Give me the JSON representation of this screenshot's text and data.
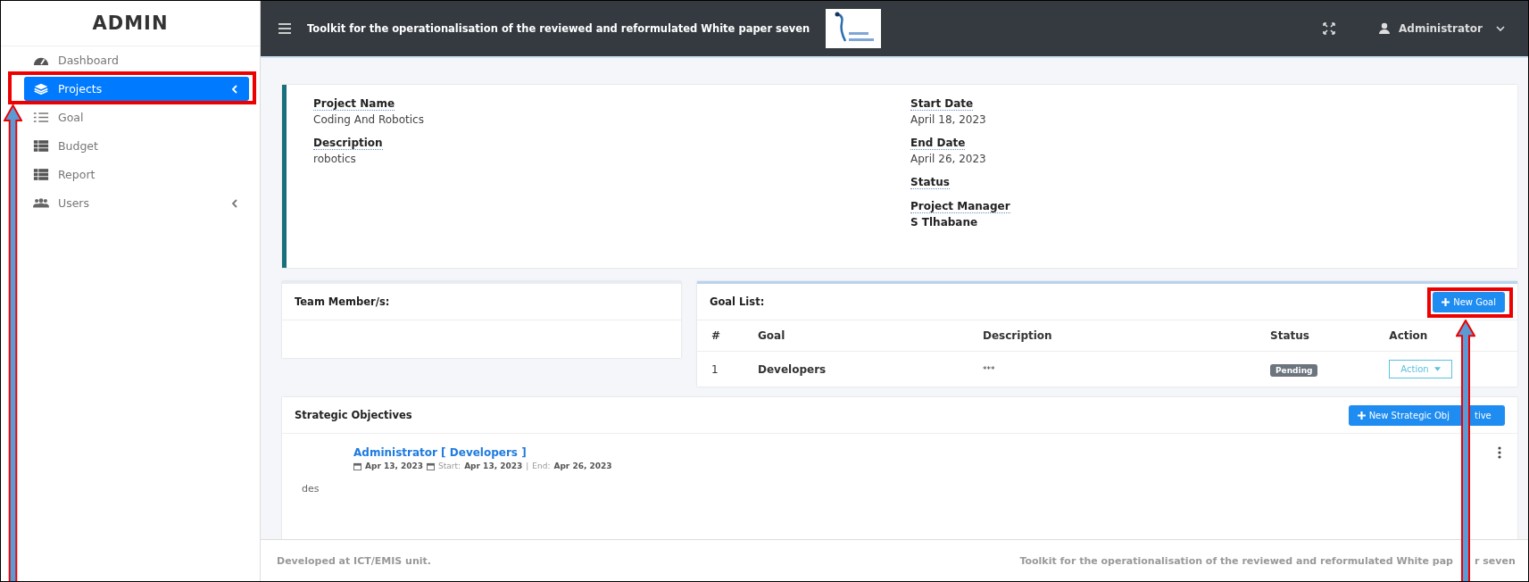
{
  "sidebar": {
    "brand": "ADMIN",
    "items": [
      {
        "label": "Dashboard",
        "selected": false,
        "has_submenu": false
      },
      {
        "label": "Projects",
        "selected": true,
        "has_submenu": true
      },
      {
        "label": "Goal",
        "selected": false,
        "has_submenu": false
      },
      {
        "label": "Budget",
        "selected": false,
        "has_submenu": false
      },
      {
        "label": "Report",
        "selected": false,
        "has_submenu": false
      },
      {
        "label": "Users",
        "selected": false,
        "has_submenu": true
      }
    ]
  },
  "header": {
    "title": "Toolkit for the operationalisation of the reviewed and reformulated White paper seven",
    "user": "Administrator"
  },
  "project": {
    "left": [
      {
        "label": "Project Name",
        "value": "Coding And Robotics",
        "kind": "plain"
      },
      {
        "label": "Description",
        "value": "robotics",
        "kind": "plain"
      }
    ],
    "right": [
      {
        "label": "Start Date",
        "value": "April 18, 2023",
        "kind": "plain"
      },
      {
        "label": "End Date",
        "value": "April 26, 2023",
        "kind": "plain"
      },
      {
        "label": "Status"
      },
      {
        "label": "Project Manager",
        "value": "S Tlhabane",
        "kind": "strong"
      }
    ]
  },
  "team": {
    "title": "Team Member/s:"
  },
  "goals": {
    "title": "Goal List:",
    "new_button": "New Goal",
    "columns": [
      "#",
      "Goal",
      "Description",
      "Status",
      "Action"
    ],
    "rows": [
      {
        "number": "1",
        "goal": "Developers",
        "description": "***",
        "status": "Pending",
        "action": "Action"
      }
    ]
  },
  "objectives": {
    "title": "Strategic Objectives",
    "new_button": [
      "New Strategic Obj",
      "tive"
    ],
    "items": [
      {
        "author": "Administrator [ Developers ]",
        "date": "Apr 13, 2023",
        "start_label": "Start:",
        "start": "Apr 13, 2023",
        "separator": "|",
        "end_label": "End:",
        "end": "Apr 26, 2023",
        "text": "des"
      }
    ]
  },
  "footer": {
    "left": "Developed at ICT/EMIS unit.",
    "right": [
      "Toolkit for the operationalisation of the reviewed and reformulated White pap",
      "r seven"
    ]
  }
}
